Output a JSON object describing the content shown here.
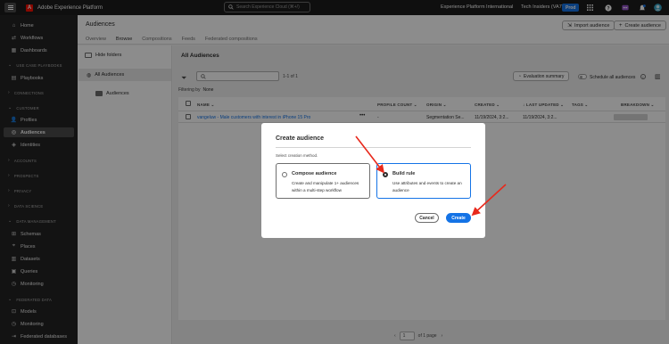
{
  "topbar": {
    "app_title": "Adobe Experience Platform",
    "search_placeholder": "Search Experience Cloud (⌘+/)",
    "org_name": "Experience Platform International",
    "tenant": "Tech Insiders (VA7)",
    "env_badge": "Prod",
    "logo_letter": "A"
  },
  "sidebar": {
    "items": [
      {
        "label": "Home",
        "icon": "home-icon",
        "glyph": "⌂"
      },
      {
        "label": "Workflows",
        "icon": "workflows-icon",
        "glyph": "⇄"
      },
      {
        "label": "Dashboards",
        "icon": "dashboards-icon",
        "glyph": "▦"
      },
      {
        "label": "Playbooks",
        "icon": "playbooks-icon",
        "glyph": "▤"
      },
      {
        "label": "Profiles",
        "icon": "profiles-icon",
        "glyph": "👤"
      },
      {
        "label": "Audiences",
        "icon": "audiences-icon",
        "glyph": "◎"
      },
      {
        "label": "Identities",
        "icon": "identities-icon",
        "glyph": "◈"
      },
      {
        "label": "Schemas",
        "icon": "schemas-icon",
        "glyph": "⊞"
      },
      {
        "label": "Places",
        "icon": "places-icon",
        "glyph": "⌖"
      },
      {
        "label": "Datasets",
        "icon": "datasets-icon",
        "glyph": "▥"
      },
      {
        "label": "Queries",
        "icon": "queries-icon",
        "glyph": "▣"
      },
      {
        "label": "Monitoring",
        "icon": "monitoring-icon",
        "glyph": "◷"
      },
      {
        "label": "Models",
        "icon": "models-icon",
        "glyph": "⊡"
      },
      {
        "label": "Monitoring",
        "icon": "monitoring-icon",
        "glyph": "◷"
      },
      {
        "label": "Federated databases",
        "icon": "federated-databases-icon",
        "glyph": "⇥"
      }
    ],
    "sections": [
      "USE CASE PLAYBOOKS",
      "CONNECTIONS",
      "CUSTOMER",
      "ACCOUNTS",
      "PROSPECTS",
      "PRIVACY",
      "DATA SCIENCE",
      "DATA MANAGEMENT",
      "FEDERATED DATA"
    ]
  },
  "header": {
    "title": "Audiences",
    "tabs": [
      "Overview",
      "Browse",
      "Compositions",
      "Feeds",
      "Federated compositions"
    ],
    "import_label": "Import audience",
    "create_label": "Create audience"
  },
  "folders": {
    "hide_label": "Hide folders",
    "all_label": "All Audiences",
    "audiences_label": "Audiences"
  },
  "content": {
    "title": "All Audiences",
    "count": "1-1 of 1",
    "eval_label": "Evaluation summary",
    "schedule_label": "Schedule all audiences",
    "filtering_label": "Filtering by",
    "filtering_value": "None",
    "columns": [
      "NAME",
      "PROFILE COUNT",
      "ORIGIN",
      "CREATED",
      "LAST UPDATED",
      "TAGS",
      "BREAKDOWN"
    ],
    "rows": [
      {
        "name": "vangeluw - Male customers with interest in iPhone 15 Pro",
        "more": "•••",
        "profile_count": "-",
        "origin": "Segmentation Se...",
        "created": "11/19/2024, 3:2...",
        "last_updated": "11/19/2024, 3:2..."
      }
    ],
    "pager_page": "1",
    "pager_of": "of 1 page"
  },
  "dialog": {
    "title": "Create audience",
    "subtitle": "Select creation method.",
    "option_compose_title": "Compose audience",
    "option_compose_desc": "Create and manipulate 1+ audiences within a multi-step workflow",
    "option_build_title": "Build rule",
    "option_build_desc": "Use attributes and events to create an audience",
    "selected_option": "Build rule",
    "cancel_label": "Cancel",
    "create_label": "Create"
  },
  "colors": {
    "accent": "#1473e6",
    "annotation_arrow": "#e8291c",
    "topbar": "#1c1c1c",
    "sidebar": "#242424"
  }
}
